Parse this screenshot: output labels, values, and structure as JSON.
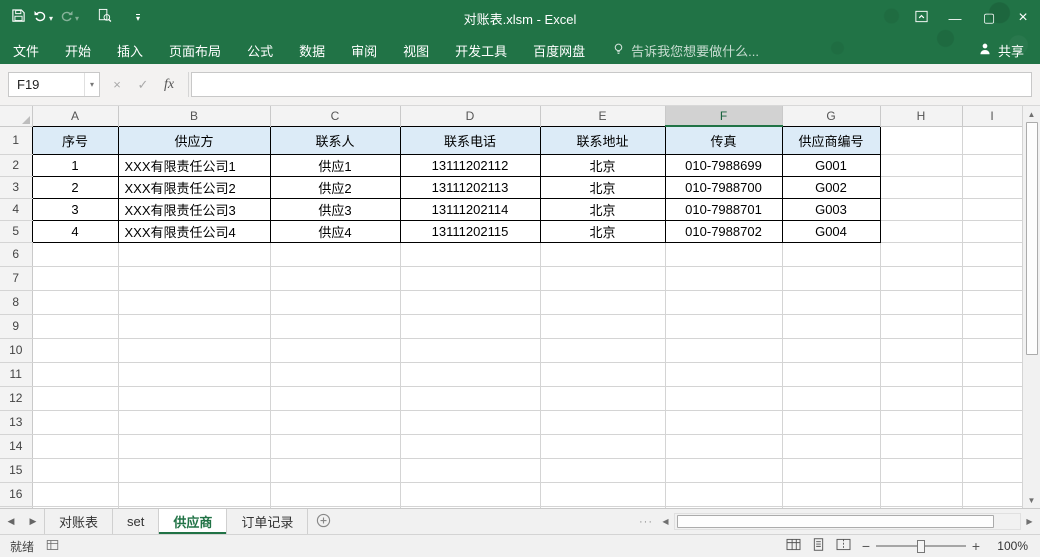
{
  "titlebar": {
    "title": "对账表.xlsm - Excel"
  },
  "ribbon": {
    "tabs": [
      "文件",
      "开始",
      "插入",
      "页面布局",
      "公式",
      "数据",
      "审阅",
      "视图",
      "开发工具",
      "百度网盘"
    ],
    "tell_me": "告诉我您想要做什么...",
    "share_label": "共享"
  },
  "formula_bar": {
    "name_box": "F19",
    "formula": "",
    "fx_label": "fx"
  },
  "grid": {
    "columns": [
      "A",
      "B",
      "C",
      "D",
      "E",
      "F",
      "G",
      "H",
      "I"
    ],
    "selected_column": "F",
    "visible_rows": 17,
    "header_row": [
      "序号",
      "供应方",
      "联系人",
      "联系电话",
      "联系地址",
      "传真",
      "供应商编号"
    ],
    "data_rows": [
      [
        "1",
        "XXX有限责任公司1",
        "供应1",
        "13111202112",
        "北京",
        "010-7988699",
        "G001"
      ],
      [
        "2",
        "XXX有限责任公司2",
        "供应2",
        "13111202113",
        "北京",
        "010-7988700",
        "G002"
      ],
      [
        "3",
        "XXX有限责任公司3",
        "供应3",
        "13111202114",
        "北京",
        "010-7988701",
        "G003"
      ],
      [
        "4",
        "XXX有限责任公司4",
        "供应4",
        "13111202115",
        "北京",
        "010-7988702",
        "G004"
      ]
    ]
  },
  "sheet_tabs": {
    "tabs": [
      {
        "label": "对账表",
        "active": false
      },
      {
        "label": "set",
        "active": false
      },
      {
        "label": "供应商",
        "active": true
      },
      {
        "label": "订单记录",
        "active": false
      }
    ]
  },
  "status_bar": {
    "ready": "就绪",
    "zoom": "100%"
  },
  "colors": {
    "accent": "#217346",
    "table_header_fill": "#DCEBF7",
    "selected_column_header": "#D2D2D2"
  }
}
